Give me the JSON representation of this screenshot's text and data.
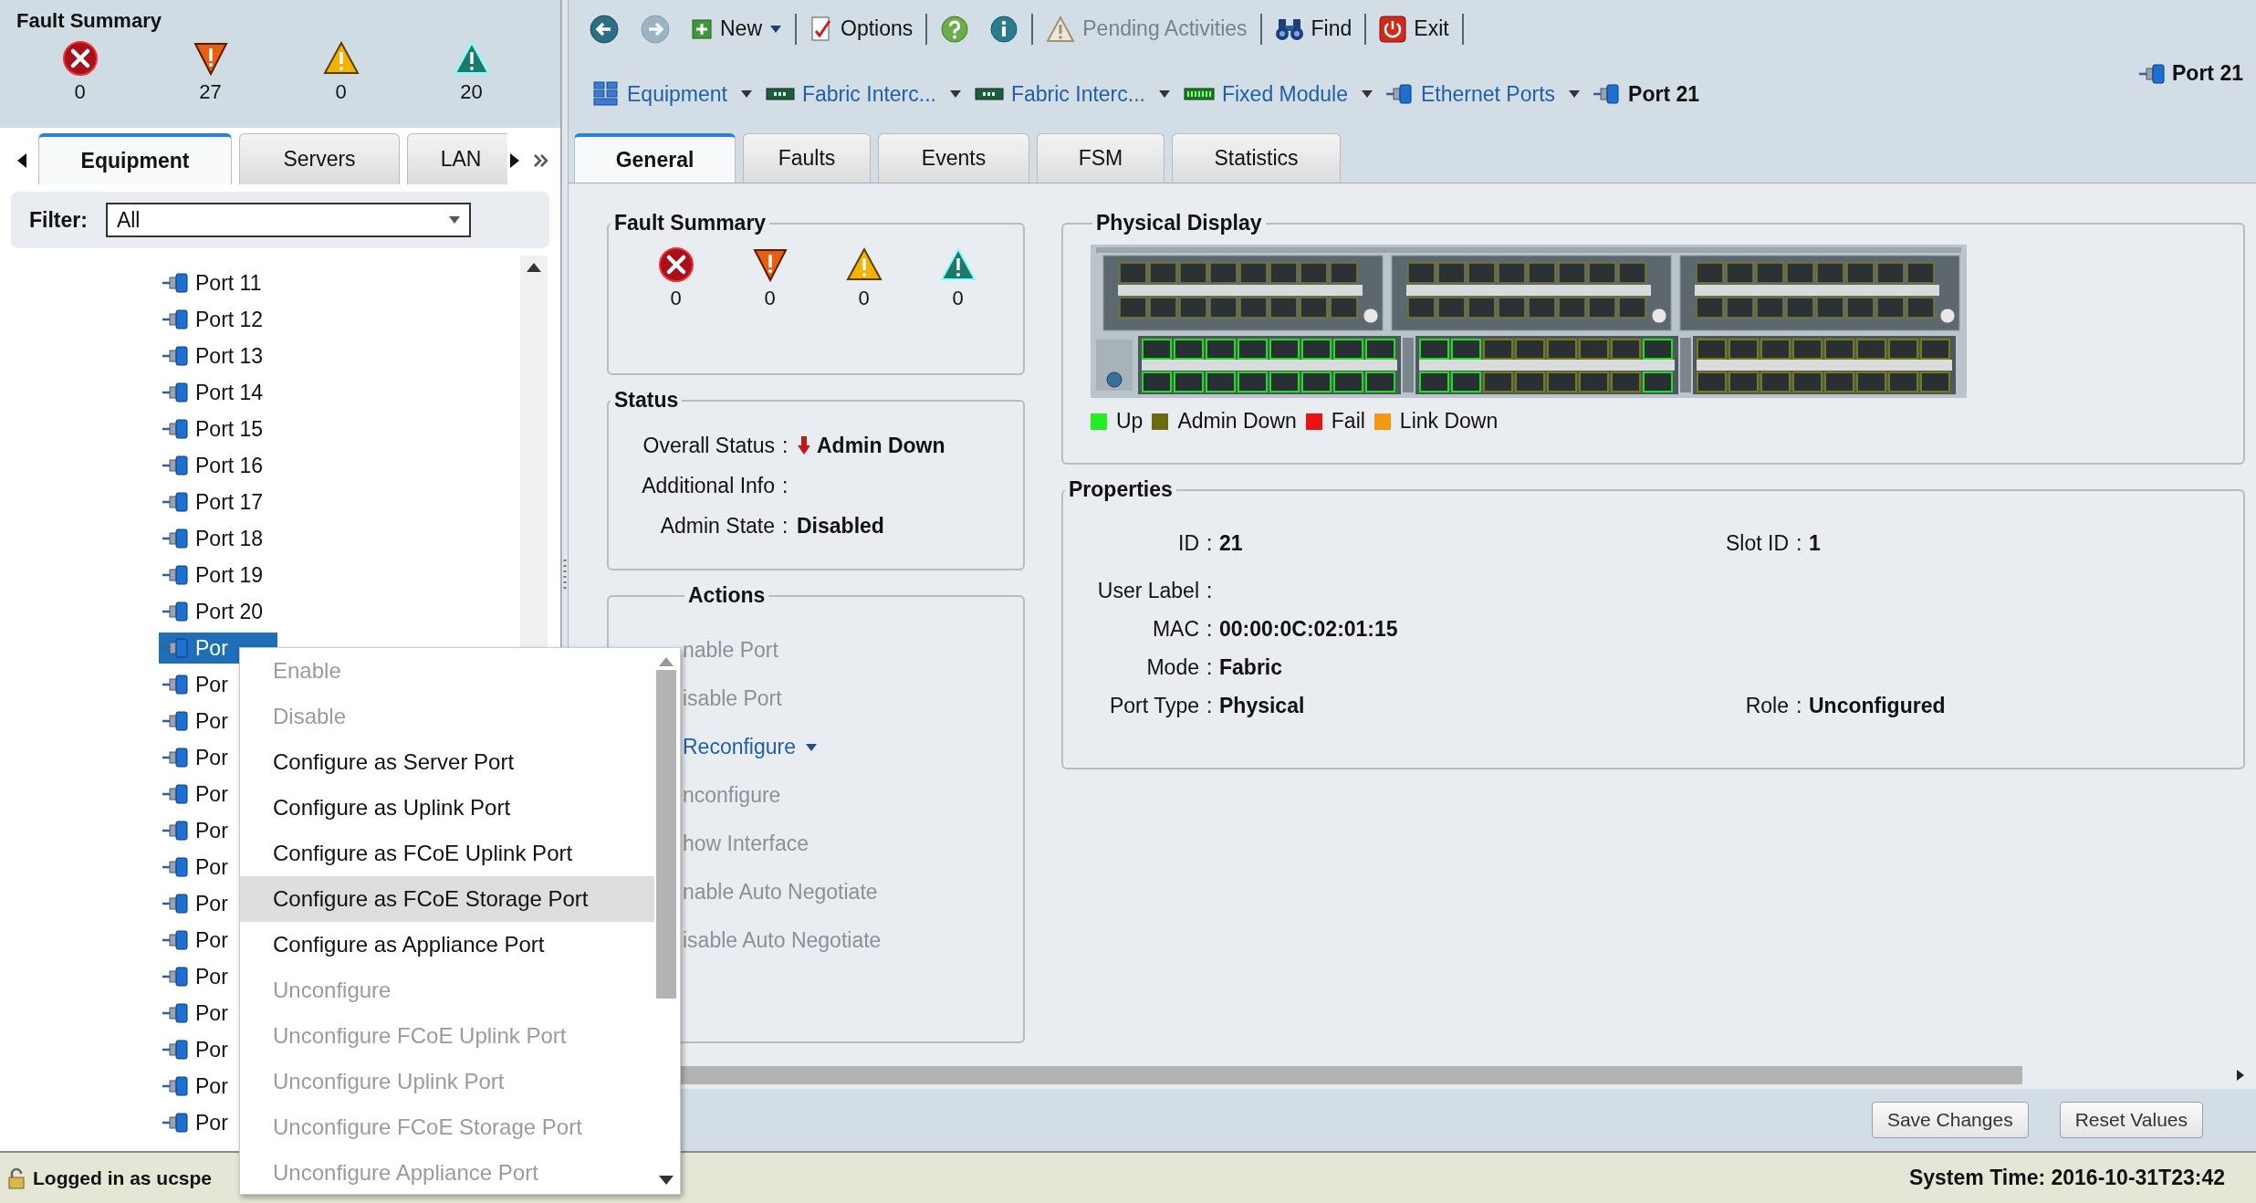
{
  "fault_summary": {
    "title": "Fault Summary",
    "items": [
      {
        "kind": "critical",
        "count": "0"
      },
      {
        "kind": "major",
        "count": "27"
      },
      {
        "kind": "minor",
        "count": "0"
      },
      {
        "kind": "warning",
        "count": "20"
      }
    ]
  },
  "nav_tabs": [
    {
      "label": "Equipment",
      "selected": true
    },
    {
      "label": "Servers",
      "selected": false
    },
    {
      "label": "LAN",
      "selected": false
    }
  ],
  "filter": {
    "label": "Filter:",
    "value": "All"
  },
  "tree": [
    {
      "label": "Port 11",
      "selected": false
    },
    {
      "label": "Port 12",
      "selected": false
    },
    {
      "label": "Port 13",
      "selected": false
    },
    {
      "label": "Port 14",
      "selected": false
    },
    {
      "label": "Port 15",
      "selected": false
    },
    {
      "label": "Port 16",
      "selected": false
    },
    {
      "label": "Port 17",
      "selected": false
    },
    {
      "label": "Port 18",
      "selected": false
    },
    {
      "label": "Port 19",
      "selected": false
    },
    {
      "label": "Port 20",
      "selected": false
    },
    {
      "label": "Por",
      "selected": true
    },
    {
      "label": "Por",
      "selected": false
    },
    {
      "label": "Por",
      "selected": false
    },
    {
      "label": "Por",
      "selected": false
    },
    {
      "label": "Por",
      "selected": false
    },
    {
      "label": "Por",
      "selected": false
    },
    {
      "label": "Por",
      "selected": false
    },
    {
      "label": "Por",
      "selected": false
    },
    {
      "label": "Por",
      "selected": false
    },
    {
      "label": "Por",
      "selected": false
    },
    {
      "label": "Por",
      "selected": false
    },
    {
      "label": "Por",
      "selected": false
    },
    {
      "label": "Por",
      "selected": false
    },
    {
      "label": "Por",
      "selected": false
    }
  ],
  "toolbar": [
    [
      {
        "kind": "back",
        "disabled": false
      },
      {
        "kind": "forward",
        "disabled": true
      },
      {
        "kind": "new",
        "label": "New",
        "menu": true,
        "disabled": false
      }
    ],
    [
      {
        "kind": "options",
        "label": "Options",
        "disabled": false
      }
    ],
    [
      {
        "kind": "help",
        "disabled": false
      },
      {
        "kind": "info",
        "disabled": false
      }
    ],
    [
      {
        "kind": "pending",
        "label": "Pending Activities",
        "disabled": true
      }
    ],
    [
      {
        "kind": "find",
        "label": "Find",
        "disabled": false
      }
    ],
    [
      {
        "kind": "exit",
        "label": "Exit",
        "disabled": false
      }
    ]
  ],
  "breadcrumb": [
    {
      "kind": "equipment",
      "label": "Equipment",
      "menu": true,
      "current": false
    },
    {
      "kind": "fabric-interconnect",
      "label": "Fabric Interc...",
      "menu": true,
      "current": false
    },
    {
      "kind": "fabric-interconnect",
      "label": "Fabric Interc...",
      "menu": true,
      "current": false
    },
    {
      "kind": "module",
      "label": "Fixed Module",
      "menu": true,
      "current": false
    },
    {
      "kind": "port",
      "label": "Ethernet Ports",
      "menu": true,
      "current": false
    },
    {
      "kind": "port",
      "label": "Port 21",
      "menu": false,
      "current": true
    }
  ],
  "page_title": "Port 21",
  "detail_tabs": [
    {
      "label": "General",
      "selected": true
    },
    {
      "label": "Faults",
      "selected": false
    },
    {
      "label": "Events",
      "selected": false
    },
    {
      "label": "FSM",
      "selected": false
    },
    {
      "label": "Statistics",
      "selected": false
    }
  ],
  "fault_panel": {
    "title": "Fault Summary",
    "items": [
      {
        "kind": "critical",
        "count": "0"
      },
      {
        "kind": "major",
        "count": "0"
      },
      {
        "kind": "minor",
        "count": "0"
      },
      {
        "kind": "warning",
        "count": "0"
      }
    ]
  },
  "status": {
    "title": "Status",
    "rows": [
      {
        "kind": "status",
        "label": "Overall Status",
        "colon": ":",
        "value": "Admin Down"
      },
      {
        "kind": "text",
        "label": "Additional Info",
        "colon": ":"
      },
      {
        "kind": "text",
        "label": "Admin State",
        "colon": ":",
        "value": "Disabled"
      }
    ]
  },
  "actions": {
    "title": "Actions",
    "items": [
      {
        "label": "nable Port",
        "disabled": true,
        "menu": false
      },
      {
        "label": "isable Port",
        "disabled": true,
        "menu": false
      },
      {
        "label": "Reconfigure",
        "disabled": false,
        "menu": true
      },
      {
        "label": "nconfigure",
        "disabled": true,
        "menu": false
      },
      {
        "label": "how Interface",
        "disabled": true,
        "menu": false
      },
      {
        "label": "nable Auto Negotiate",
        "disabled": true,
        "menu": false
      },
      {
        "label": "isable Auto Negotiate",
        "disabled": true,
        "menu": false
      }
    ]
  },
  "physical_display": {
    "title": "Physical Display",
    "legend": [
      {
        "label": "Up",
        "color": "#22ee22"
      },
      {
        "label": "Admin Down",
        "color": "#6b6b10"
      },
      {
        "label": "Fail",
        "color": "#ee1111"
      },
      {
        "label": "Link Down",
        "color": "#f59a10"
      }
    ]
  },
  "properties": {
    "title": "Properties",
    "rows": [
      {
        "label": "ID",
        "colon": ":",
        "value": "21",
        "right": {
          "label": "Slot ID",
          "colon": ":",
          "value": "1"
        }
      },
      {
        "label": "User Label",
        "colon": ":"
      },
      {
        "label": "MAC",
        "colon": ":",
        "value": "00:00:0C:02:01:15"
      },
      {
        "label": "Mode",
        "colon": ":",
        "value": "Fabric"
      },
      {
        "label": "Port Type",
        "colon": ":",
        "value": "Physical",
        "right": {
          "label": "Role",
          "colon": ":",
          "value": "Unconfigured"
        }
      }
    ]
  },
  "buttons": [
    "Save Changes",
    "Reset Values"
  ],
  "context_menu": [
    {
      "label": "Enable",
      "disabled": true,
      "highlighted": false
    },
    {
      "label": "Disable",
      "disabled": true,
      "highlighted": false
    },
    {
      "label": "Configure as Server Port",
      "disabled": false,
      "highlighted": false
    },
    {
      "label": "Configure as Uplink Port",
      "disabled": false,
      "highlighted": false
    },
    {
      "label": "Configure as FCoE Uplink Port",
      "disabled": false,
      "highlighted": false
    },
    {
      "label": "Configure as FCoE Storage Port",
      "disabled": false,
      "highlighted": true
    },
    {
      "label": "Configure as Appliance Port",
      "disabled": false,
      "highlighted": false
    },
    {
      "label": "Unconfigure",
      "disabled": true,
      "highlighted": false
    },
    {
      "label": "Unconfigure FCoE Uplink Port",
      "disabled": true,
      "highlighted": false
    },
    {
      "label": "Unconfigure Uplink Port",
      "disabled": true,
      "highlighted": false
    },
    {
      "label": "Unconfigure FCoE Storage Port",
      "disabled": true,
      "highlighted": false
    },
    {
      "label": "Unconfigure Appliance Port",
      "disabled": true,
      "highlighted": false
    }
  ],
  "status_bar": {
    "user": "Logged in as ucspe",
    "time": "System Time: 2016-10-31T23:42"
  }
}
